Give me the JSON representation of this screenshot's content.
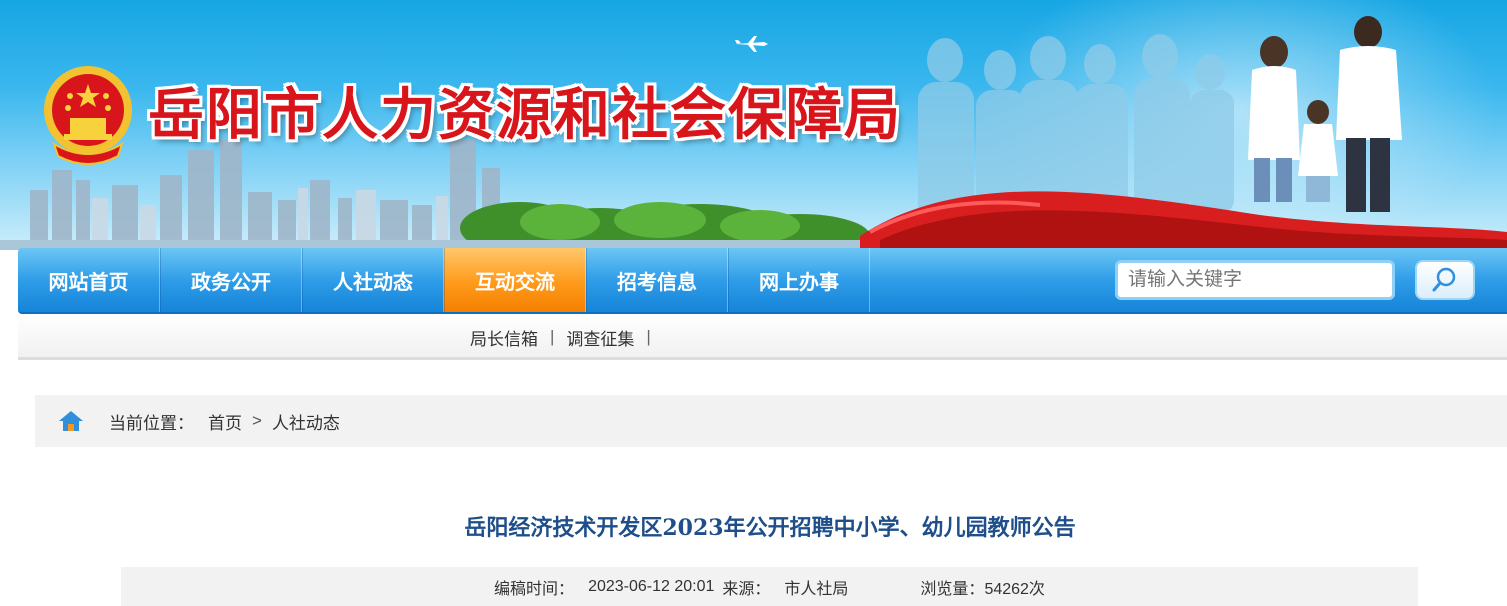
{
  "banner": {
    "site_title": "岳阳市人力资源和社会保障局"
  },
  "nav": {
    "items": [
      {
        "label": "网站首页"
      },
      {
        "label": "政务公开"
      },
      {
        "label": "人社动态"
      },
      {
        "label": "互动交流",
        "active": true
      },
      {
        "label": "招考信息"
      },
      {
        "label": "网上办事"
      }
    ],
    "search_placeholder": "请输入关键字"
  },
  "subnav": {
    "links": [
      "局长信箱",
      "调查征集"
    ]
  },
  "breadcrumb": {
    "prefix": "当前位置：",
    "items": [
      "首页",
      "人社动态"
    ]
  },
  "article": {
    "title": "岳阳经济技术开发区2023年公开招聘中小学、幼儿园教师公告",
    "meta": {
      "time_label": "编稿时间：",
      "time_value": "2023-06-12 20:01",
      "source_label": "来源：",
      "source_value": "市人社局",
      "views_label": "浏览量：",
      "views_value": "54262次"
    }
  },
  "colors": {
    "title_red": "#d7151b",
    "nav_blue": "#1684d8",
    "nav_active_orange": "#ff9a1a",
    "article_title_blue": "#1e4f8a"
  }
}
